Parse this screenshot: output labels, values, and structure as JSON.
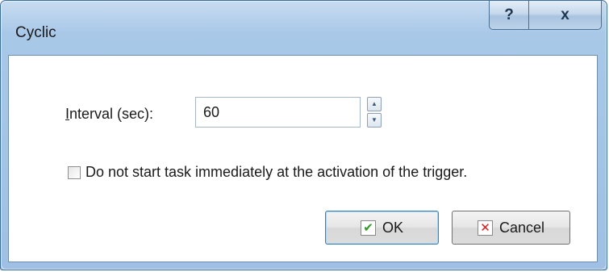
{
  "window": {
    "title": "Cyclic",
    "help_label": "?",
    "close_label": "x"
  },
  "form": {
    "interval_label_accel": "I",
    "interval_label_rest": "nterval (sec):",
    "interval_value": "60",
    "spin_up_icon": "▲",
    "spin_down_icon": "▼",
    "checkbox_checked": false,
    "checkbox_label": "Do not start task immediately at the activation of the trigger."
  },
  "buttons": {
    "ok_icon": "✔",
    "ok_label": "OK",
    "cancel_icon": "✕",
    "cancel_label": "Cancel"
  },
  "colors": {
    "ok_icon": "#2e9a25",
    "cancel_icon": "#d11f1f",
    "frame": "#a9c8e8"
  }
}
